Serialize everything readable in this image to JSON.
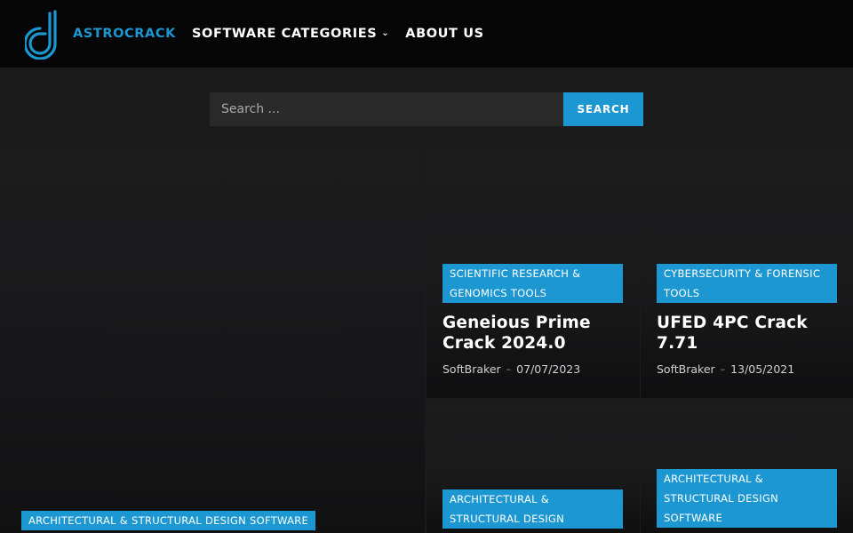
{
  "header": {
    "brand": "ASTROCRACK",
    "nav": [
      {
        "label": "SOFTWARE CATEGORIES",
        "has_dropdown": true
      },
      {
        "label": "ABOUT US"
      }
    ]
  },
  "search": {
    "placeholder": "Search ...",
    "button": "SEARCH"
  },
  "hero": {
    "category": "ARCHITECTURAL & STRUCTURAL DESIGN SOFTWARE"
  },
  "cards": [
    {
      "category": "SCIENTIFIC RESEARCH & GENOMICS TOOLS",
      "title": "Geneious Prime Crack 2024.0",
      "author": "SoftBraker",
      "date": "07/07/2023"
    },
    {
      "category": "CYBERSECURITY & FORENSIC TOOLS",
      "title": "UFED 4PC Crack 7.71",
      "author": "SoftBraker",
      "date": "13/05/2021"
    },
    {
      "category": "ARCHITECTURAL & STRUCTURAL DESIGN"
    },
    {
      "category": "ARCHITECTURAL & STRUCTURAL DESIGN SOFTWARE"
    }
  ],
  "meta_separator": "–",
  "colors": {
    "accent": "#1c97d2",
    "header_bg": "#050505",
    "page_bg": "#1b1b1c"
  }
}
